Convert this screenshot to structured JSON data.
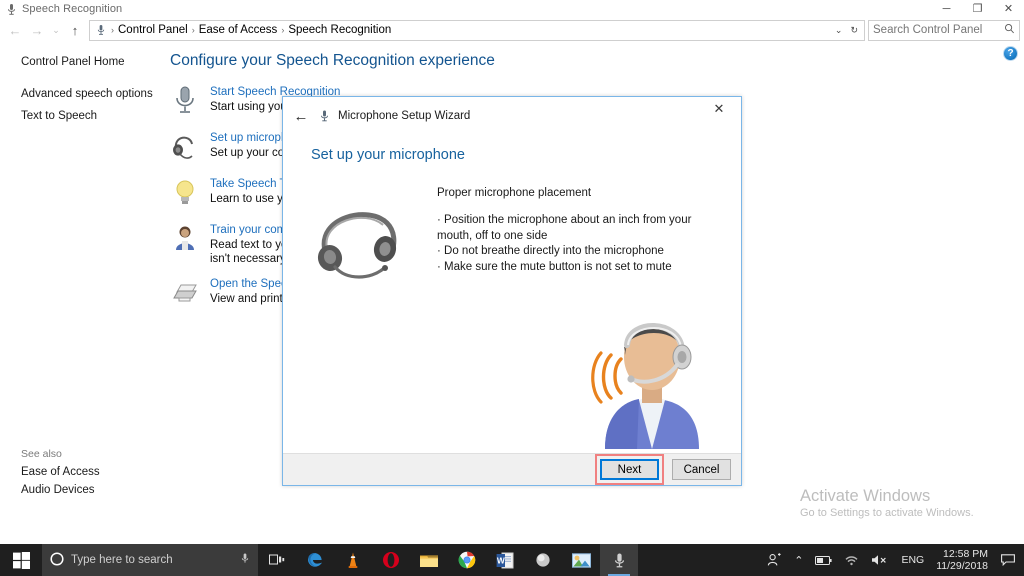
{
  "window": {
    "title": "Speech Recognition",
    "title_icon": "microphone-icon",
    "minimize_label": "─",
    "maximize_label": "❐",
    "close_label": "✕"
  },
  "nav": {
    "back_label": "←",
    "forward_label": "→",
    "recent_label": "⌄",
    "up_label": "↑",
    "refresh_label": "↻",
    "dropdown_label": "⌄",
    "breadcrumb_icon": "microphone-icon",
    "breadcrumbs": [
      "Control Panel",
      "Ease of Access",
      "Speech Recognition"
    ],
    "separator": "›"
  },
  "search": {
    "placeholder": "Search Control Panel",
    "icon": "search-icon"
  },
  "sidebar": {
    "home_label": "Control Panel Home",
    "items": [
      {
        "label": "Advanced speech options"
      },
      {
        "label": "Text to Speech"
      }
    ],
    "see_also": {
      "header": "See also",
      "links": [
        {
          "label": "Ease of Access"
        },
        {
          "label": "Audio Devices"
        }
      ]
    }
  },
  "main": {
    "page_title": "Configure your Speech Recognition experience",
    "help_label": "?",
    "tasks": [
      {
        "icon": "microphone-icon",
        "link": "Start Speech Recognition",
        "desc": "Start using your voice"
      },
      {
        "icon": "headset-icon",
        "link": "Set up microphone",
        "desc": "Set up your compute"
      },
      {
        "icon": "lightbulb-icon",
        "link": "Take Speech Tutorial",
        "desc": "Learn to use your cor"
      },
      {
        "icon": "user-training-icon",
        "link": "Train your computer",
        "desc": "Read text to your con",
        "desc2": "isn't necessary, but ca"
      },
      {
        "icon": "printer-icon",
        "link": "Open the Speech Ref",
        "desc": "View and print a list o"
      }
    ]
  },
  "dialog": {
    "wizard_title": "Microphone Setup Wizard",
    "wizard_icon": "microphone-icon",
    "back_label": "←",
    "close_label": "✕",
    "heading": "Set up your microphone",
    "illustration_headset": "headset-image",
    "illustration_person": "person-with-headset-image",
    "lead": "Proper microphone placement",
    "bullets": [
      "Position the microphone about an inch from your mouth, off to one side",
      "Do not breathe directly into the microphone",
      "Make sure the mute button is not set to mute"
    ],
    "next_label": "Next",
    "cancel_label": "Cancel"
  },
  "watermark": {
    "line1": "Activate Windows",
    "line2": "Go to Settings to activate Windows."
  },
  "taskbar": {
    "start_label": "start-icon",
    "search_placeholder": "Type here to search",
    "search_circle_icon": "cortana-circle-icon",
    "search_mic_icon": "microphone-icon",
    "buttons": [
      {
        "name": "task-view",
        "icon": "task-view-icon"
      },
      {
        "name": "edge",
        "icon": "edge-icon"
      },
      {
        "name": "vlc",
        "icon": "vlc-cone-icon"
      },
      {
        "name": "opera",
        "icon": "opera-icon"
      },
      {
        "name": "file-explorer",
        "icon": "folder-icon"
      },
      {
        "name": "chrome",
        "icon": "chrome-icon"
      },
      {
        "name": "word",
        "icon": "word-icon"
      },
      {
        "name": "sphere-app",
        "icon": "sphere-icon"
      },
      {
        "name": "photos-app",
        "icon": "picture-icon"
      },
      {
        "name": "speech-recognition",
        "icon": "microphone-icon"
      }
    ],
    "tray": {
      "people_icon": "people-icon",
      "chevron_icon": "⌃",
      "battery_icon": "battery-icon",
      "wifi_icon": "wifi-icon",
      "volume_icon": "volume-mute-icon",
      "language": "ENG",
      "time": "12:58 PM",
      "date": "11/29/2018",
      "notification_icon": "notification-icon"
    }
  },
  "colors": {
    "accent_blue": "#1e6fbd",
    "title_blue": "#13548f",
    "dialog_border": "#7ab6e8",
    "highlight_red": "#f08080",
    "focus_blue": "#0078d7",
    "taskbar_bg": "#1f1f1f"
  }
}
